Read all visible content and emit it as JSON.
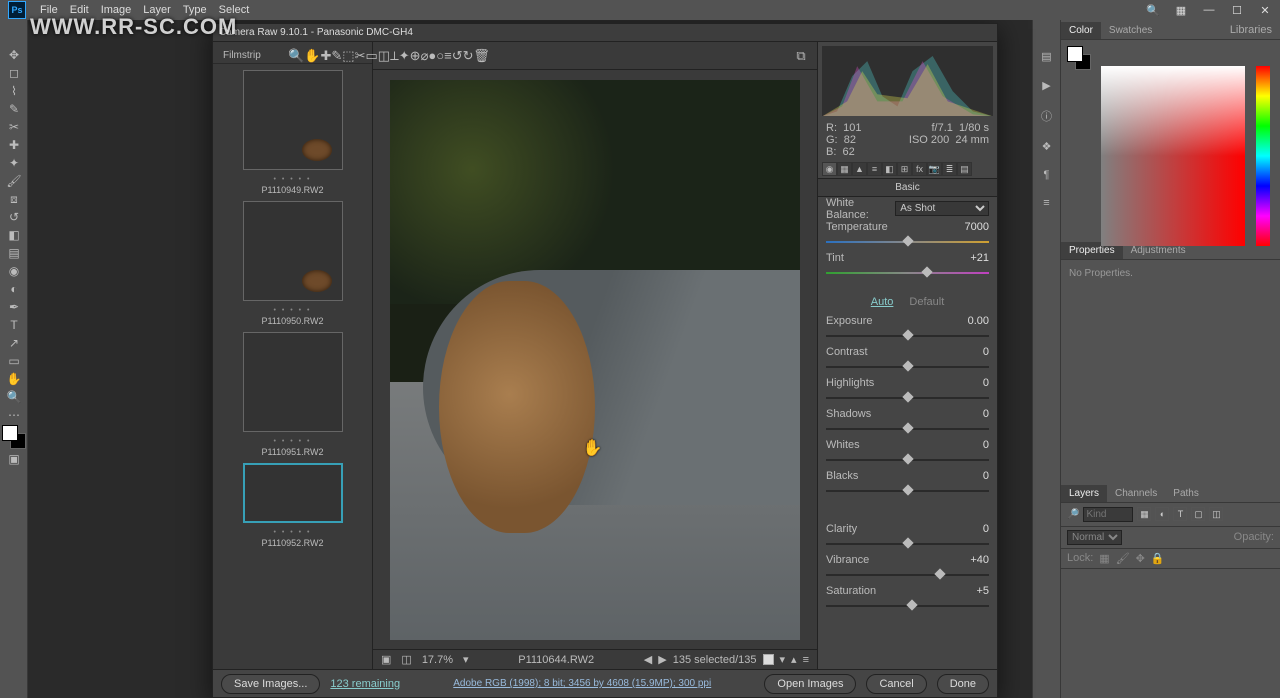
{
  "menubar": {
    "items": [
      "File",
      "Edit",
      "Image",
      "Layer",
      "Type",
      "Select"
    ],
    "win_min": "—",
    "win_max": "☐",
    "win_close": "✕",
    "search": "🔍",
    "panels": "▦"
  },
  "watermark": "WWW.RR-SC.COM",
  "acr": {
    "title": "Camera Raw 9.10.1  -  Panasonic DMC-GH4",
    "filmstrip_label": "Filmstrip",
    "thumbs": [
      {
        "name": "P1110949.RW2",
        "style": "bark",
        "wide": false,
        "sel": false,
        "knot": true
      },
      {
        "name": "P1110950.RW2",
        "style": "bark",
        "wide": false,
        "sel": false,
        "knot": true
      },
      {
        "name": "P1110951.RW2",
        "style": "bark2",
        "wide": false,
        "sel": false,
        "knot": false
      },
      {
        "name": "P1110952.RW2",
        "style": "log",
        "wide": true,
        "sel": true,
        "knot": false
      }
    ],
    "tools": [
      "🔍",
      "✋",
      "✚",
      "✎",
      "⬚",
      "✂",
      "▭",
      "◫",
      "⟂",
      "✦",
      "⊕",
      "⌀",
      "●",
      "○",
      "≡",
      "↺",
      "↻",
      "🗑"
    ],
    "tool_right": "⧉",
    "zoom": "17.7%",
    "current_file": "P1110644.RW2",
    "sel_info": "135 selected/135",
    "readout": {
      "r_label": "R:",
      "r": "101",
      "g_label": "G:",
      "g": "82",
      "b_label": "B:",
      "b": "62",
      "aperture": "f/7.1",
      "shutter": "1/80 s",
      "iso": "ISO 200",
      "focal": "24 mm"
    },
    "section_title": "Basic",
    "wb_label": "White Balance:",
    "wb_value": "As Shot",
    "auto": "Auto",
    "default": "Default",
    "sliders": [
      {
        "key": "temperature",
        "label": "Temperature",
        "value": "7000",
        "pos": 50,
        "track": "grad-temp"
      },
      {
        "key": "tint",
        "label": "Tint",
        "value": "+21",
        "pos": 62,
        "track": "grad-tint"
      },
      {
        "key": "exposure",
        "label": "Exposure",
        "value": "0.00",
        "pos": 50,
        "track": ""
      },
      {
        "key": "contrast",
        "label": "Contrast",
        "value": "0",
        "pos": 50,
        "track": ""
      },
      {
        "key": "highlights",
        "label": "Highlights",
        "value": "0",
        "pos": 50,
        "track": ""
      },
      {
        "key": "shadows",
        "label": "Shadows",
        "value": "0",
        "pos": 50,
        "track": ""
      },
      {
        "key": "whites",
        "label": "Whites",
        "value": "0",
        "pos": 50,
        "track": ""
      },
      {
        "key": "blacks",
        "label": "Blacks",
        "value": "0",
        "pos": 50,
        "track": ""
      },
      {
        "key": "clarity",
        "label": "Clarity",
        "value": "0",
        "pos": 50,
        "track": ""
      },
      {
        "key": "vibrance",
        "label": "Vibrance",
        "value": "+40",
        "pos": 70,
        "track": ""
      },
      {
        "key": "saturation",
        "label": "Saturation",
        "value": "+5",
        "pos": 53,
        "track": ""
      }
    ],
    "footer": {
      "save": "Save Images...",
      "remaining": "123 remaining",
      "workflow": "Adobe RGB (1998); 8 bit; 3456 by 4608 (15.9MP); 300 ppi",
      "open": "Open Images",
      "cancel": "Cancel",
      "done": "Done"
    }
  },
  "panels": {
    "color_tab": "Color",
    "swatches_tab": "Swatches",
    "libraries_tab": "Libraries",
    "properties_tab": "Properties",
    "adjustments_tab": "Adjustments",
    "no_properties": "No Properties.",
    "layers_tab": "Layers",
    "channels_tab": "Channels",
    "paths_tab": "Paths",
    "filter_placeholder": "Kind",
    "blend": "Normal",
    "opacity": "Opacity:",
    "lock": "Lock:"
  }
}
